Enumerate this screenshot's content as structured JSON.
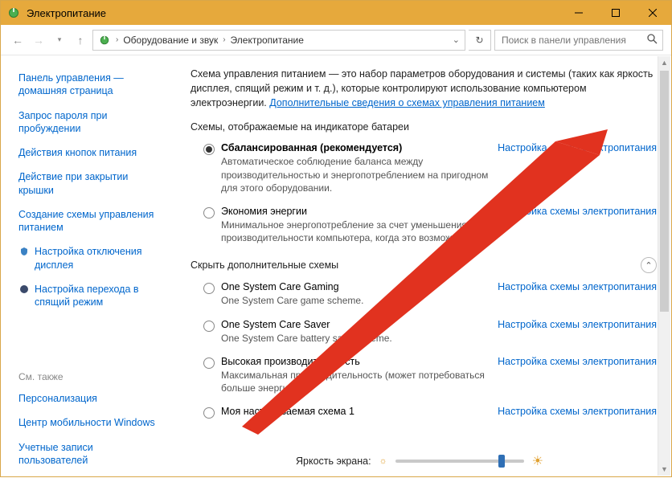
{
  "window": {
    "title": "Электропитание"
  },
  "breadcrumb": {
    "seg1": "Оборудование и звук",
    "seg2": "Электропитание"
  },
  "search": {
    "placeholder": "Поиск в панели управления"
  },
  "sidebar": {
    "links": [
      "Панель управления — домашняя страница",
      "Запрос пароля при пробуждении",
      "Действия кнопок питания",
      "Действие при закрытии крышки",
      "Создание схемы управления питанием",
      "Настройка отключения дисплея",
      "Настройка перехода в спящий режим"
    ],
    "see_also_label": "См. также",
    "see_also": [
      "Персонализация",
      "Центр мобильности Windows",
      "Учетные записи пользователей"
    ]
  },
  "intro": {
    "text_a": "Схема управления питанием — это набор параметров оборудования и системы (таких как яркость дисплея, спящий режим и т. д.), которые контролируют использование компьютером электроэнергии. ",
    "link": "Дополнительные сведения о схемах управления питанием"
  },
  "main": {
    "section1_label": "Схемы, отображаемые на индикаторе батареи",
    "section2_label": "Скрыть дополнительные схемы",
    "configure_link": "Настройка схемы электропитания",
    "plans_primary": [
      {
        "name": "Сбалансированная (рекомендуется)",
        "desc": "Автоматическое соблюдение баланса между производительностью и энергопотреблением на пригодном для этого оборудовании.",
        "selected": true
      },
      {
        "name": "Экономия энергии",
        "desc": "Минимальное энергопотребление за счет уменьшения производительности компьютера, когда это возможно.",
        "selected": false
      }
    ],
    "plans_extra": [
      {
        "name": "One System Care Gaming",
        "desc": "One System Care game scheme.",
        "selected": false
      },
      {
        "name": "One System Care Saver",
        "desc": "One System Care battery save scheme.",
        "selected": false
      },
      {
        "name": "Высокая производительность",
        "desc": "Максимальная производительность (может потребоваться больше энергии).",
        "selected": false
      },
      {
        "name": "Моя настраиваемая схема 1",
        "desc": "",
        "selected": false
      }
    ]
  },
  "brightness": {
    "label": "Яркость экрана:",
    "value_pct": 80
  },
  "colors": {
    "title_bg": "#e6a93c",
    "link": "#0066cc",
    "arrow": "#e1321f"
  }
}
